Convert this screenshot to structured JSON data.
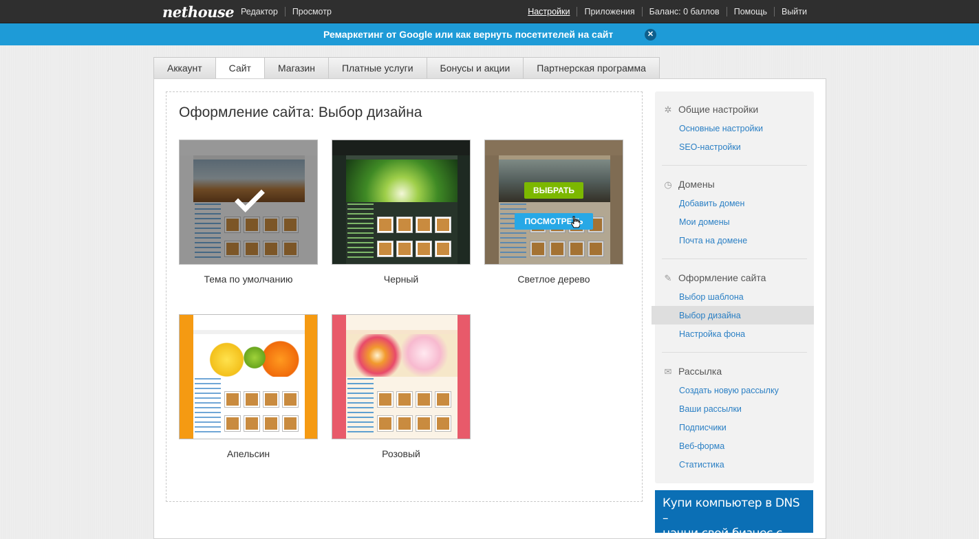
{
  "topbar": {
    "logo": "nethouse",
    "left_nav": [
      "Редактор",
      "Просмотр"
    ],
    "right_nav": [
      "Настройки",
      "Приложения",
      "Баланс: 0 баллов",
      "Помощь",
      "Выйти"
    ],
    "active": "Настройки"
  },
  "promo": {
    "text": "Ремаркетинг от Google или как вернуть посетителей на сайт",
    "close_icon": "close-icon"
  },
  "tabs": [
    {
      "label": "Аккаунт"
    },
    {
      "label": "Сайт",
      "active": true
    },
    {
      "label": "Магазин"
    },
    {
      "label": "Платные услуги"
    },
    {
      "label": "Бонусы и акции"
    },
    {
      "label": "Партнерская программа"
    }
  ],
  "main": {
    "title": "Оформление сайта: Выбор дизайна",
    "themes": [
      {
        "name": "Тема по умолчанию",
        "selected": true
      },
      {
        "name": "Черный"
      },
      {
        "name": "Светлое дерево",
        "hover": true,
        "choose_label": "ВЫБРАТЬ",
        "view_label": "ПОСМОТРЕТЬ"
      },
      {
        "name": "Апельсин"
      },
      {
        "name": "Розовый"
      }
    ]
  },
  "sidebar": {
    "groups": [
      {
        "title": "Общие настройки",
        "icon": "gear-icon",
        "links": [
          "Основные настройки",
          "SEO-настройки"
        ]
      },
      {
        "title": "Домены",
        "icon": "clock-icon",
        "links": [
          "Добавить домен",
          "Мои домены",
          "Почта на домене"
        ]
      },
      {
        "title": "Оформление сайта",
        "icon": "pencil-icon",
        "links": [
          "Выбор шаблона",
          "Выбор дизайна",
          "Настройка фона"
        ],
        "active_link": "Выбор дизайна"
      },
      {
        "title": "Рассылка",
        "icon": "envelope-icon",
        "links": [
          "Создать новую рассылку",
          "Ваши рассылки",
          "Подписчики",
          "Веб-форма",
          "Статистика"
        ]
      }
    ]
  },
  "ad": {
    "line1": "Купи компьютер в DNS –",
    "line2": "начни свой бизнес с Intel",
    "reg": "®",
    "line2_end": "!"
  },
  "colors": {
    "topbar": "#2f2f2f",
    "promo": "#1e9bd7",
    "link": "#2a7fc4",
    "choose_button": "#7cb800",
    "view_button": "#27a8e6",
    "ad_bg": "#0b6fb5"
  }
}
